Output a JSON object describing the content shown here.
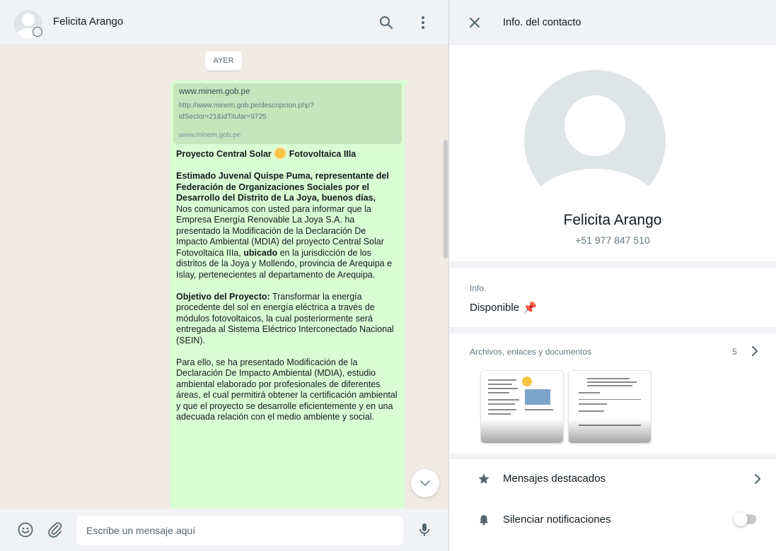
{
  "chat": {
    "contact_name": "Felicita Arango",
    "day_label": "AYER",
    "link_preview": {
      "title": "www.minem.gob.pe",
      "url": "http://www.minem.gob.pe/descripcion.php?idSector=21&idTitular=9725",
      "domain": "www.minem.gob.pe"
    },
    "message": {
      "title_pre": "Proyecto Central Solar",
      "title_post": "Fotovoltaica IIIa",
      "greeting": "Estimado Juvenal Quispe Puma, representante del Federación de Organizaciones Sociales por el Desarrollo del Distrito de La Joya, buenos días,",
      "body1_pre": "Nos comunicamos con usted para informar que la Empresa Energía Renovable La Joya S.A. ha presentado la Modificación de la Declaración De Impacto Ambiental (MDIA) del proyecto Central Solar Fotovoltaica IIIa,",
      "body1_bold": "ubicado",
      "body1_post": "en la jurisdicción de los distritos de la Joya y Mollendo, provincia de Arequipa e Islay, pertenecientes al departamento de Arequipa.",
      "objective_label": "Objetivo del Proyecto:",
      "objective_text": "Transformar la energía procedente del sol en energía eléctrica a través de módulos fotovoltaicos, la cual posteriormente será entregada al Sistema Eléctrico Interconectado Nacional (SEIN).",
      "body2": "Para ello, se ha presentado Modificación de la Declaración De Impacto Ambiental (MDIA), estudio ambiental elaborado por profesionales de diferentes áreas, el cual permitirá obtener la certificación ambiental y que el proyecto se desarrolle eficientemente y en una adecuada relación con el medio ambiente y social."
    },
    "input_placeholder": "Escribe un mensaje aquí"
  },
  "info": {
    "header_title": "Info. del contacto",
    "name": "Felicita Arango",
    "phone": "+51 977 847 510",
    "about_label": "Info.",
    "about_text": "Disponible",
    "media_label": "Archivos, enlaces y documentos",
    "media_count": "5",
    "starred_label": "Mensajes destacados",
    "mute_label": "Silenciar notificaciones"
  },
  "colors": {
    "bubble": "#d9fdd3",
    "panel": "#f0f2f5",
    "icon": "#54656f"
  },
  "icons": [
    "search-icon",
    "menu-icon",
    "close-icon",
    "emoji-icon",
    "attach-icon",
    "mic-icon",
    "chevron-down-icon",
    "chevron-right-icon",
    "star-icon",
    "bell-icon",
    "pin-icon",
    "sun-emoji"
  ]
}
